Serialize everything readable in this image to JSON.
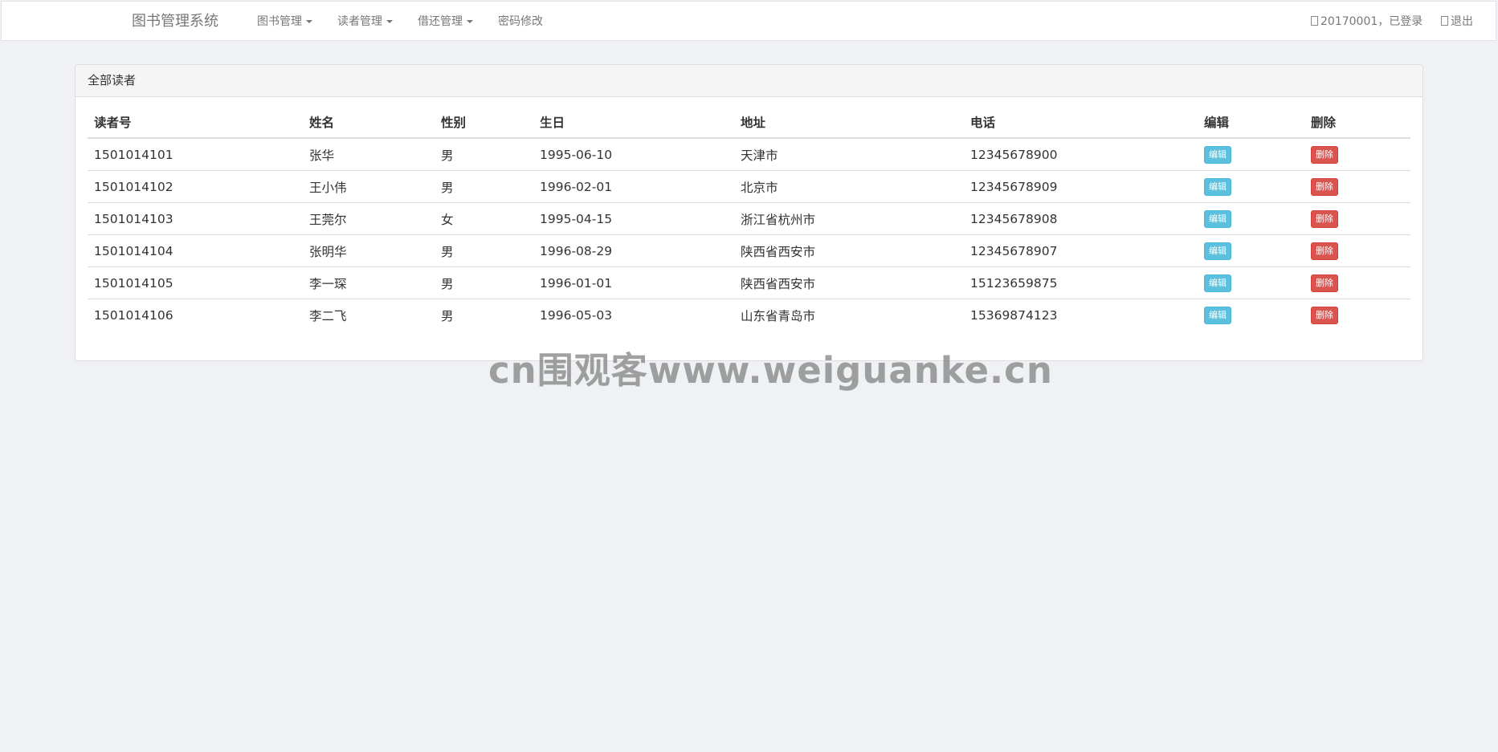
{
  "navbar": {
    "brand": "图书管理系统",
    "menu": [
      {
        "label": "图书管理"
      },
      {
        "label": "读者管理"
      },
      {
        "label": "借还管理"
      }
    ],
    "password_change": "密码修改",
    "user_status": "20170001，已登录",
    "logout": "退出"
  },
  "panel": {
    "title": "全部读者",
    "columns": [
      "读者号",
      "姓名",
      "性别",
      "生日",
      "地址",
      "电话",
      "编辑",
      "删除"
    ],
    "edit_label": "编辑",
    "delete_label": "删除",
    "rows": [
      {
        "id": "1501014101",
        "name": "张华",
        "gender": "男",
        "birthday": "1995-06-10",
        "address": "天津市",
        "phone": "12345678900"
      },
      {
        "id": "1501014102",
        "name": "王小伟",
        "gender": "男",
        "birthday": "1996-02-01",
        "address": "北京市",
        "phone": "12345678909"
      },
      {
        "id": "1501014103",
        "name": "王莞尔",
        "gender": "女",
        "birthday": "1995-04-15",
        "address": "浙江省杭州市",
        "phone": "12345678908"
      },
      {
        "id": "1501014104",
        "name": "张明华",
        "gender": "男",
        "birthday": "1996-08-29",
        "address": "陕西省西安市",
        "phone": "12345678907"
      },
      {
        "id": "1501014105",
        "name": "李一琛",
        "gender": "男",
        "birthday": "1996-01-01",
        "address": "陕西省西安市",
        "phone": "15123659875"
      },
      {
        "id": "1501014106",
        "name": "李二飞",
        "gender": "男",
        "birthday": "1996-05-03",
        "address": "山东省青岛市",
        "phone": "15369874123"
      }
    ]
  },
  "watermark": "cn围观客www.weiguanke.cn"
}
